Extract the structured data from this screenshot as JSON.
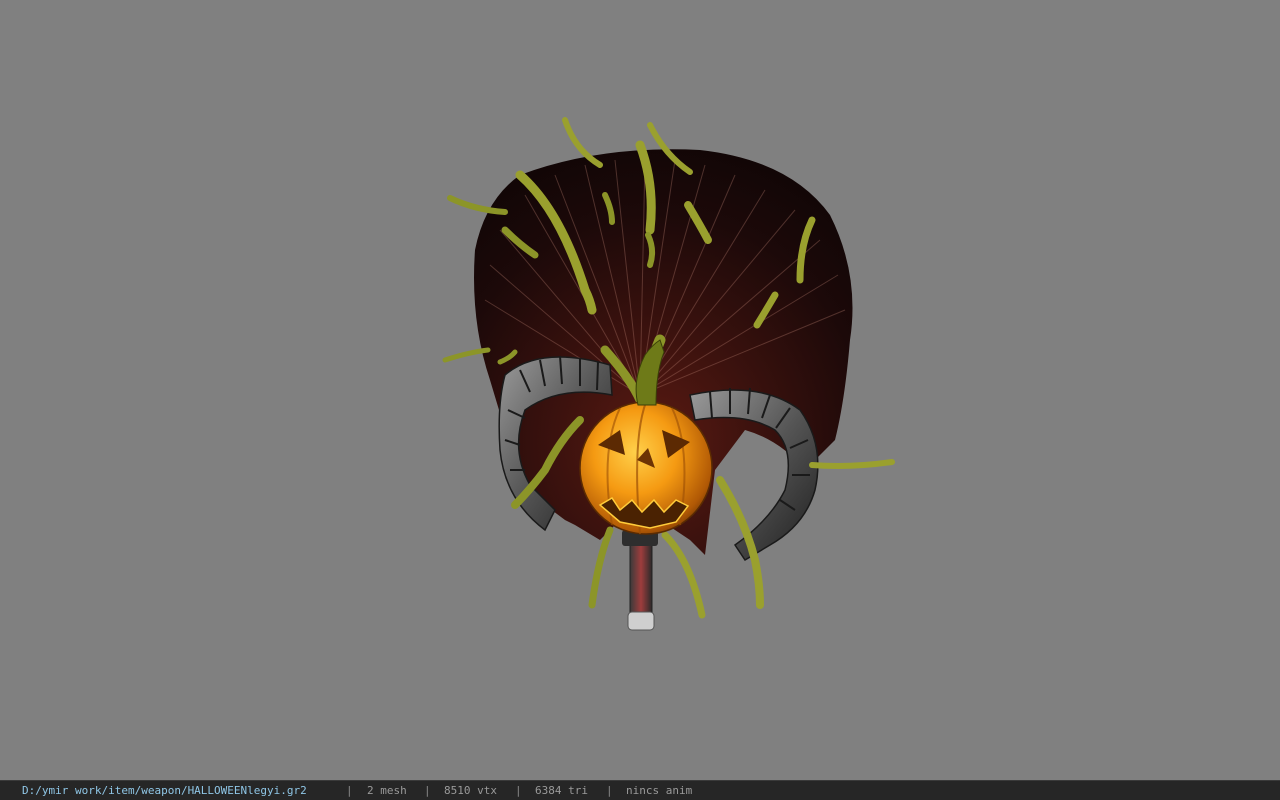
{
  "viewer": {
    "background_color": "#808080",
    "model_name": "HALLOWEENlegyi"
  },
  "statusbar": {
    "file_path": "D:/ymir work/item/weapon/HALLOWEENlegyi.gr2",
    "separator": "|",
    "mesh_count": "2 mesh",
    "vertex_count": "8510 vtx",
    "triangle_count": "6384 tri",
    "anim_status": "nincs anim",
    "path_color": "#8fc6e6"
  }
}
